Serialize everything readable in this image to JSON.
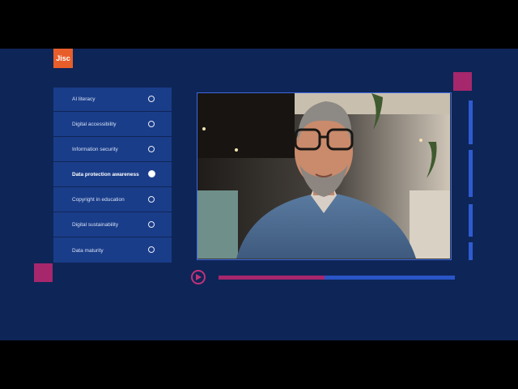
{
  "brand": {
    "logo_text": "Jisc",
    "logo_color": "#e85e2b"
  },
  "menu": {
    "items": [
      {
        "label": "AI literacy",
        "active": false
      },
      {
        "label": "Digital accessibility",
        "active": false
      },
      {
        "label": "Information security",
        "active": false
      },
      {
        "label": "Data protection awareness",
        "active": true
      },
      {
        "label": "Copyright in education",
        "active": false
      },
      {
        "label": "Digital sustainability",
        "active": false
      },
      {
        "label": "Data maturity",
        "active": false
      }
    ]
  },
  "video": {
    "description_icon": "play-icon",
    "progress_fraction": 0.45
  },
  "colors": {
    "background": "#0e2557",
    "panel": "#1a3d89",
    "accent": "#a6276c",
    "blue_accent": "#2f5bd1"
  }
}
